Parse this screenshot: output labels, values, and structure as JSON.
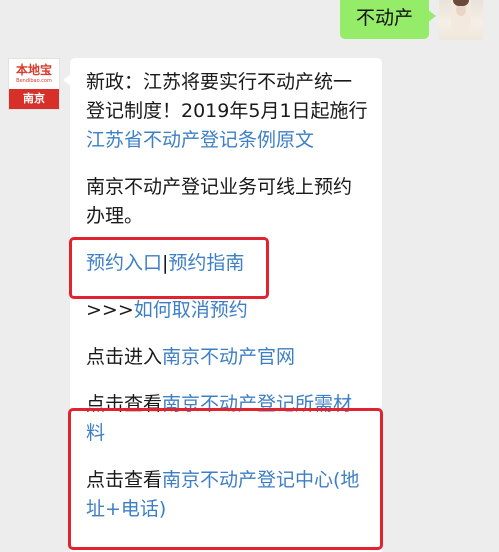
{
  "outgoing": {
    "text": "不动产"
  },
  "sender": {
    "logo_name": "本地宝",
    "logo_url": "Bendibao.com",
    "logo_city": "南京"
  },
  "message": {
    "intro_text": "新政：江苏将要实行不动产统一登记制度！2019年5月1日起施行 ",
    "intro_link": "江苏省不动产登记条例原文",
    "online_text": "南京不动产登记业务可线上预约办理。",
    "booking_entry": "预约入口",
    "separator": "|",
    "booking_guide": "预约指南",
    "cancel_prefix": ">>>",
    "cancel_link": "如何取消预约",
    "official_prefix": "点击进入",
    "official_link": "南京不动产官网",
    "materials_prefix": "点击查看",
    "materials_link": "南京不动产登记所需材料",
    "center_prefix": "点击查看",
    "center_link": "南京不动产登记中心(地址+电话)"
  },
  "colors": {
    "bubble_out": "#95ec69",
    "link": "#3d7fc5",
    "annotation": "#e0232e",
    "background": "#ededed"
  }
}
